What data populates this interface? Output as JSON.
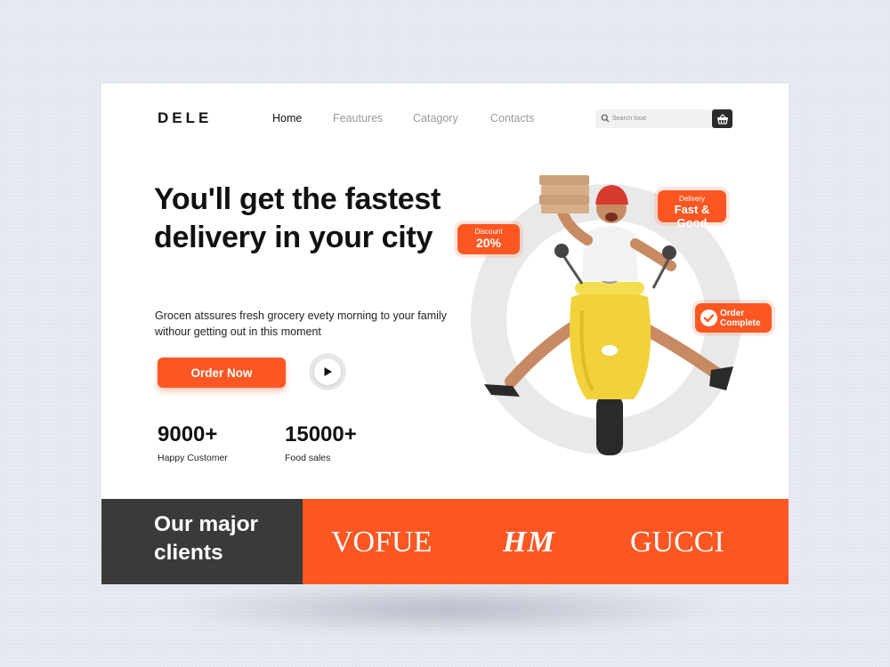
{
  "header": {
    "logo": "DELE",
    "nav": [
      "Home",
      "Feautures",
      "Catagory",
      "Contacts"
    ],
    "active_nav": "Home",
    "search": {
      "placeholder": "Search food"
    }
  },
  "hero": {
    "headline": "You'll get the fastest delivery in your city",
    "subtext": "Grocen atssures fresh grocery evety morning to your family withour getting out in this moment",
    "cta": "Order Now",
    "stats": [
      {
        "value": "9000+",
        "label": "Happy Customer"
      },
      {
        "value": "15000+",
        "label": "Food sales"
      }
    ],
    "tags": {
      "discount": {
        "small": "Discount",
        "big": "20%"
      },
      "delivery": {
        "small": "Delivery",
        "big": "Fast & Good"
      },
      "order": {
        "line1": "Order",
        "line2": "Complete"
      }
    }
  },
  "clients": {
    "title": "Our major clients",
    "brands": [
      "VOFUE",
      "HM",
      "GUCCI"
    ]
  },
  "colors": {
    "accent": "#fc5722",
    "dark": "#3a3a3a",
    "background": "#e3e7f0"
  },
  "icons": [
    "search-icon",
    "basket-icon",
    "play-icon",
    "check-icon"
  ]
}
